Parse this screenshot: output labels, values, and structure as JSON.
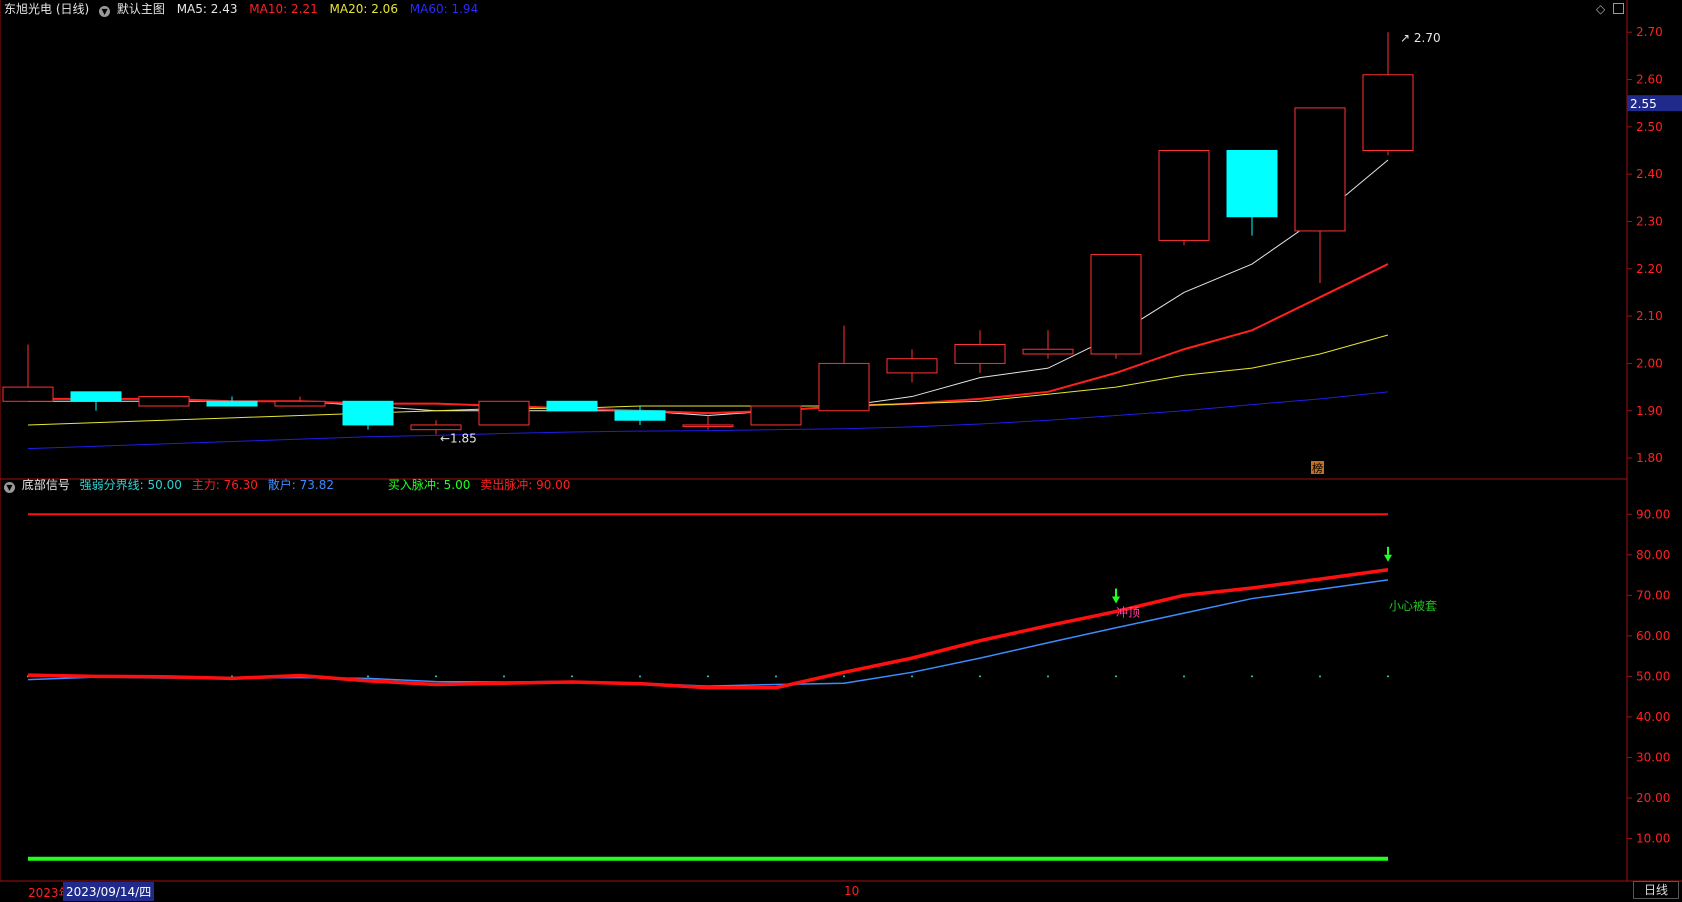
{
  "colors": {
    "background": "#000000",
    "up": "#ff3232",
    "down": "#00ffff",
    "ma5": "#e6e6e6",
    "ma10": "#ff2020",
    "ma20": "#e6e632",
    "ma60": "#1e1ee6",
    "axis": "#b4b4b4",
    "mainforce": "#ff1010",
    "retail": "#3c8cff",
    "pulse_sell": "#ff1010",
    "pulse_buy": "#20ff20"
  },
  "price_header": {
    "stock": "东旭光电 (日线)",
    "template": "默认主图",
    "ma5": "MA5: 2.43",
    "ma10": "MA10: 2.21",
    "ma20": "MA20: 2.06",
    "ma60": "MA60: 1.94"
  },
  "indicator_header": {
    "name": "底部信号",
    "boundary": "强弱分界线: 50.00",
    "mainforce": "主力: 76.30",
    "retail": "散户: 73.82",
    "buy_pulse": "买入脉冲: 5.00",
    "sell_pulse": "卖出脉冲: 90.00"
  },
  "chart_data": [
    {
      "type": "candlestick",
      "title": "东旭光电 (日线)",
      "ylim": [
        1.76,
        2.73
      ],
      "yticks": [
        "2.70",
        "2.60",
        "2.50",
        "2.40",
        "2.30",
        "2.20",
        "2.10",
        "2.00",
        "1.90",
        "1.80"
      ],
      "current_price": "2.55",
      "high_label": "2.70",
      "low_label": "1.85",
      "badge": "榜",
      "candles": [
        {
          "o": 1.92,
          "h": 2.04,
          "l": 1.92,
          "c": 1.95
        },
        {
          "o": 1.94,
          "h": 1.94,
          "l": 1.9,
          "c": 1.92
        },
        {
          "o": 1.91,
          "h": 1.93,
          "l": 1.91,
          "c": 1.93
        },
        {
          "o": 1.92,
          "h": 1.93,
          "l": 1.91,
          "c": 1.91
        },
        {
          "o": 1.91,
          "h": 1.93,
          "l": 1.91,
          "c": 1.92
        },
        {
          "o": 1.92,
          "h": 1.92,
          "l": 1.86,
          "c": 1.87
        },
        {
          "o": 1.86,
          "h": 1.88,
          "l": 1.85,
          "c": 1.87
        },
        {
          "o": 1.87,
          "h": 1.92,
          "l": 1.87,
          "c": 1.92
        },
        {
          "o": 1.92,
          "h": 1.92,
          "l": 1.9,
          "c": 1.9
        },
        {
          "o": 1.9,
          "h": 1.91,
          "l": 1.87,
          "c": 1.88
        },
        {
          "o": 1.87,
          "h": 1.89,
          "l": 1.86,
          "c": 1.87
        },
        {
          "o": 1.87,
          "h": 1.91,
          "l": 1.87,
          "c": 1.91
        },
        {
          "o": 1.9,
          "h": 2.08,
          "l": 1.9,
          "c": 2.0
        },
        {
          "o": 1.98,
          "h": 2.03,
          "l": 1.96,
          "c": 2.01
        },
        {
          "o": 2.0,
          "h": 2.07,
          "l": 1.98,
          "c": 2.04
        },
        {
          "o": 2.02,
          "h": 2.07,
          "l": 2.01,
          "c": 2.03
        },
        {
          "o": 2.02,
          "h": 2.23,
          "l": 2.01,
          "c": 2.23
        },
        {
          "o": 2.26,
          "h": 2.45,
          "l": 2.25,
          "c": 2.45
        },
        {
          "o": 2.45,
          "h": 2.45,
          "l": 2.27,
          "c": 2.31
        },
        {
          "o": 2.28,
          "h": 2.54,
          "l": 2.17,
          "c": 2.54
        },
        {
          "o": 2.45,
          "h": 2.7,
          "l": 2.44,
          "c": 2.61
        }
      ],
      "series": [
        {
          "name": "MA5",
          "values": [
            1.92,
            1.92,
            1.92,
            1.92,
            1.92,
            1.91,
            1.9,
            1.9,
            1.9,
            1.9,
            1.89,
            1.9,
            1.91,
            1.93,
            1.97,
            1.99,
            2.06,
            2.15,
            2.21,
            2.31,
            2.43
          ]
        },
        {
          "name": "MA10",
          "values": [
            1.925,
            1.925,
            1.925,
            1.92,
            1.92,
            1.915,
            1.915,
            1.91,
            1.905,
            1.9,
            1.895,
            1.9,
            1.91,
            1.915,
            1.925,
            1.94,
            1.98,
            2.03,
            2.07,
            2.14,
            2.21
          ]
        },
        {
          "name": "MA20",
          "values": [
            1.87,
            1.875,
            1.88,
            1.885,
            1.89,
            1.895,
            1.9,
            1.905,
            1.905,
            1.91,
            1.91,
            1.91,
            1.91,
            1.915,
            1.92,
            1.935,
            1.95,
            1.975,
            1.99,
            2.02,
            2.06
          ]
        },
        {
          "name": "MA60",
          "values": [
            1.82,
            1.825,
            1.83,
            1.835,
            1.84,
            1.845,
            1.848,
            1.852,
            1.855,
            1.857,
            1.858,
            1.86,
            1.862,
            1.866,
            1.872,
            1.88,
            1.89,
            1.9,
            1.913,
            1.925,
            1.94
          ]
        }
      ]
    },
    {
      "type": "line",
      "title": "底部信号",
      "ylim": [
        0,
        95
      ],
      "yticks": [
        "90.00",
        "80.00",
        "70.00",
        "60.00",
        "50.00",
        "40.00",
        "30.00",
        "20.00",
        "10.00"
      ],
      "series": [
        {
          "name": "主力",
          "values": [
            50.3,
            50.0,
            49.9,
            49.5,
            50.2,
            48.9,
            48.0,
            48.3,
            48.6,
            48.2,
            47.2,
            47.2,
            51.0,
            54.5,
            58.8,
            62.5,
            66.0,
            70.0,
            71.8,
            74.0,
            76.3
          ]
        },
        {
          "name": "散户",
          "values": [
            49.2,
            49.8,
            49.6,
            49.6,
            49.7,
            49.5,
            48.7,
            48.6,
            48.8,
            48.3,
            47.6,
            48.0,
            48.3,
            51.0,
            54.5,
            58.3,
            62.0,
            65.6,
            69.2,
            71.5,
            73.82
          ]
        },
        {
          "name": "强弱分界线",
          "value": 50
        },
        {
          "name": "卖出脉冲",
          "value": 90
        },
        {
          "name": "买入脉冲",
          "value": 5
        }
      ],
      "annotations": [
        {
          "text": "冲顶",
          "index": 16
        },
        {
          "text": "小心被套",
          "index": 20
        }
      ],
      "markers": [
        16,
        20
      ]
    }
  ],
  "time_bar": {
    "year": "2023年",
    "date": "2023/09/14/四",
    "month": "10",
    "period": "日线"
  }
}
